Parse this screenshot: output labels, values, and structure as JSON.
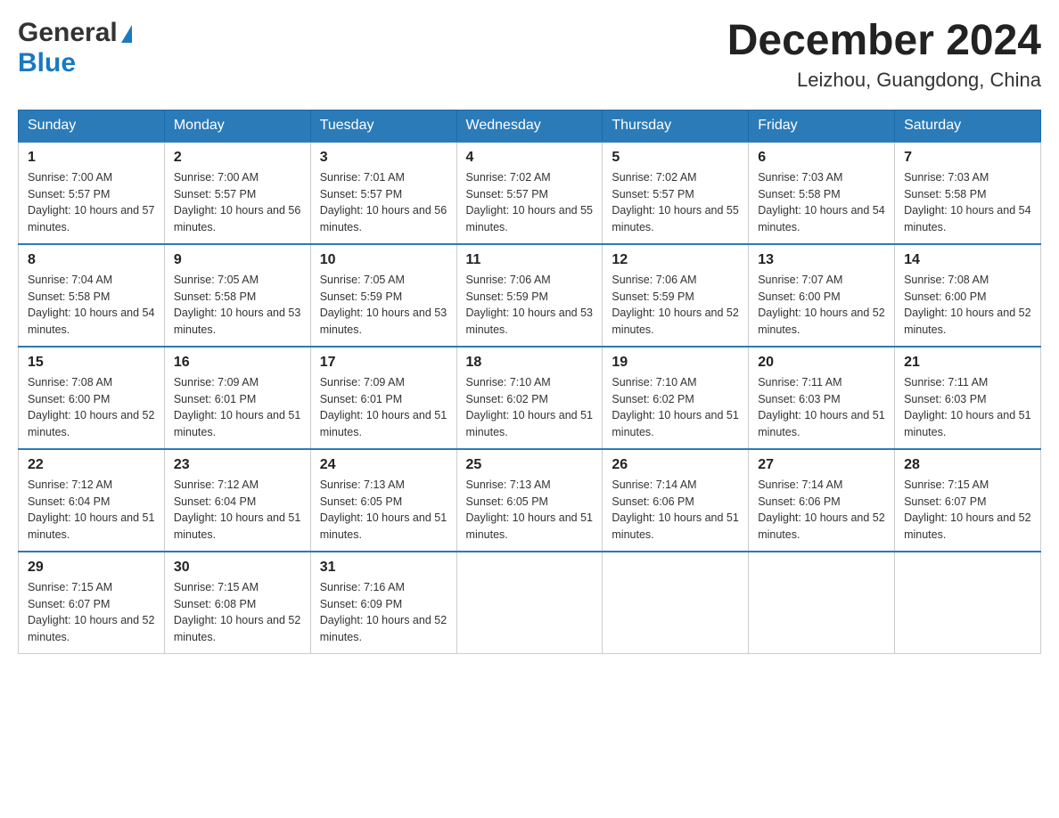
{
  "header": {
    "logo_general": "General",
    "logo_blue": "Blue",
    "month_title": "December 2024",
    "location": "Leizhou, Guangdong, China"
  },
  "days_of_week": [
    "Sunday",
    "Monday",
    "Tuesday",
    "Wednesday",
    "Thursday",
    "Friday",
    "Saturday"
  ],
  "weeks": [
    [
      {
        "day": "1",
        "sunrise": "7:00 AM",
        "sunset": "5:57 PM",
        "daylight": "10 hours and 57 minutes."
      },
      {
        "day": "2",
        "sunrise": "7:00 AM",
        "sunset": "5:57 PM",
        "daylight": "10 hours and 56 minutes."
      },
      {
        "day": "3",
        "sunrise": "7:01 AM",
        "sunset": "5:57 PM",
        "daylight": "10 hours and 56 minutes."
      },
      {
        "day": "4",
        "sunrise": "7:02 AM",
        "sunset": "5:57 PM",
        "daylight": "10 hours and 55 minutes."
      },
      {
        "day": "5",
        "sunrise": "7:02 AM",
        "sunset": "5:57 PM",
        "daylight": "10 hours and 55 minutes."
      },
      {
        "day": "6",
        "sunrise": "7:03 AM",
        "sunset": "5:58 PM",
        "daylight": "10 hours and 54 minutes."
      },
      {
        "day": "7",
        "sunrise": "7:03 AM",
        "sunset": "5:58 PM",
        "daylight": "10 hours and 54 minutes."
      }
    ],
    [
      {
        "day": "8",
        "sunrise": "7:04 AM",
        "sunset": "5:58 PM",
        "daylight": "10 hours and 54 minutes."
      },
      {
        "day": "9",
        "sunrise": "7:05 AM",
        "sunset": "5:58 PM",
        "daylight": "10 hours and 53 minutes."
      },
      {
        "day": "10",
        "sunrise": "7:05 AM",
        "sunset": "5:59 PM",
        "daylight": "10 hours and 53 minutes."
      },
      {
        "day": "11",
        "sunrise": "7:06 AM",
        "sunset": "5:59 PM",
        "daylight": "10 hours and 53 minutes."
      },
      {
        "day": "12",
        "sunrise": "7:06 AM",
        "sunset": "5:59 PM",
        "daylight": "10 hours and 52 minutes."
      },
      {
        "day": "13",
        "sunrise": "7:07 AM",
        "sunset": "6:00 PM",
        "daylight": "10 hours and 52 minutes."
      },
      {
        "day": "14",
        "sunrise": "7:08 AM",
        "sunset": "6:00 PM",
        "daylight": "10 hours and 52 minutes."
      }
    ],
    [
      {
        "day": "15",
        "sunrise": "7:08 AM",
        "sunset": "6:00 PM",
        "daylight": "10 hours and 52 minutes."
      },
      {
        "day": "16",
        "sunrise": "7:09 AM",
        "sunset": "6:01 PM",
        "daylight": "10 hours and 51 minutes."
      },
      {
        "day": "17",
        "sunrise": "7:09 AM",
        "sunset": "6:01 PM",
        "daylight": "10 hours and 51 minutes."
      },
      {
        "day": "18",
        "sunrise": "7:10 AM",
        "sunset": "6:02 PM",
        "daylight": "10 hours and 51 minutes."
      },
      {
        "day": "19",
        "sunrise": "7:10 AM",
        "sunset": "6:02 PM",
        "daylight": "10 hours and 51 minutes."
      },
      {
        "day": "20",
        "sunrise": "7:11 AM",
        "sunset": "6:03 PM",
        "daylight": "10 hours and 51 minutes."
      },
      {
        "day": "21",
        "sunrise": "7:11 AM",
        "sunset": "6:03 PM",
        "daylight": "10 hours and 51 minutes."
      }
    ],
    [
      {
        "day": "22",
        "sunrise": "7:12 AM",
        "sunset": "6:04 PM",
        "daylight": "10 hours and 51 minutes."
      },
      {
        "day": "23",
        "sunrise": "7:12 AM",
        "sunset": "6:04 PM",
        "daylight": "10 hours and 51 minutes."
      },
      {
        "day": "24",
        "sunrise": "7:13 AM",
        "sunset": "6:05 PM",
        "daylight": "10 hours and 51 minutes."
      },
      {
        "day": "25",
        "sunrise": "7:13 AM",
        "sunset": "6:05 PM",
        "daylight": "10 hours and 51 minutes."
      },
      {
        "day": "26",
        "sunrise": "7:14 AM",
        "sunset": "6:06 PM",
        "daylight": "10 hours and 51 minutes."
      },
      {
        "day": "27",
        "sunrise": "7:14 AM",
        "sunset": "6:06 PM",
        "daylight": "10 hours and 52 minutes."
      },
      {
        "day": "28",
        "sunrise": "7:15 AM",
        "sunset": "6:07 PM",
        "daylight": "10 hours and 52 minutes."
      }
    ],
    [
      {
        "day": "29",
        "sunrise": "7:15 AM",
        "sunset": "6:07 PM",
        "daylight": "10 hours and 52 minutes."
      },
      {
        "day": "30",
        "sunrise": "7:15 AM",
        "sunset": "6:08 PM",
        "daylight": "10 hours and 52 minutes."
      },
      {
        "day": "31",
        "sunrise": "7:16 AM",
        "sunset": "6:09 PM",
        "daylight": "10 hours and 52 minutes."
      },
      null,
      null,
      null,
      null
    ]
  ],
  "labels": {
    "sunrise_prefix": "Sunrise: ",
    "sunset_prefix": "Sunset: ",
    "daylight_prefix": "Daylight: "
  }
}
